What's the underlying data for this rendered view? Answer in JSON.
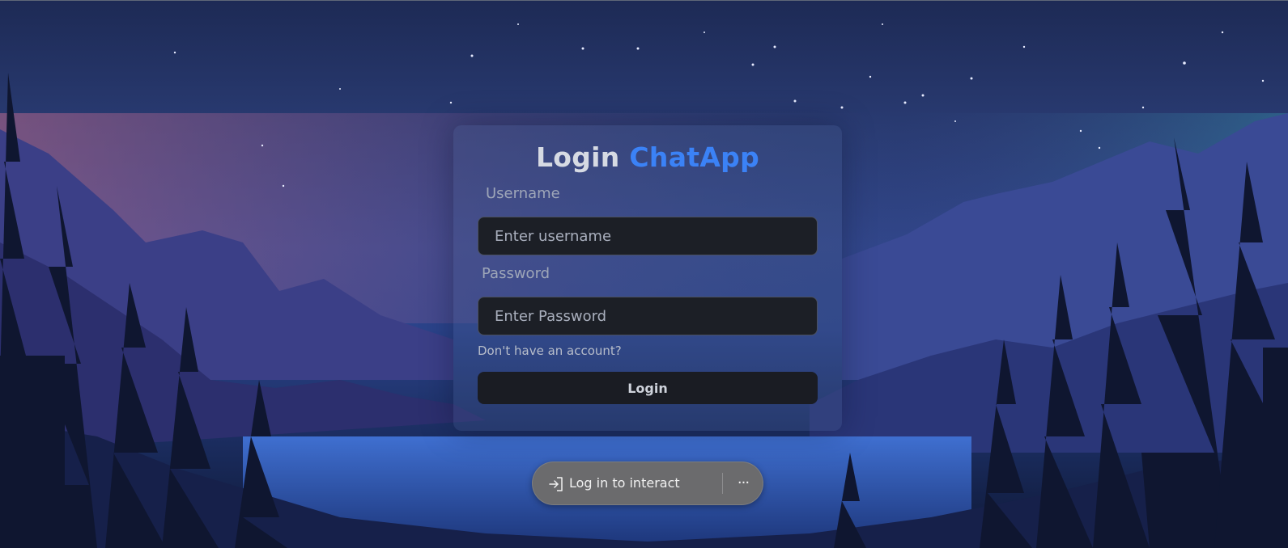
{
  "login_form": {
    "title_prefix": "Login",
    "title_brand": "ChatApp",
    "username_label": "Username",
    "username_placeholder": "Enter username",
    "username_value": "",
    "password_label": "Password",
    "password_placeholder": "Enter Password",
    "password_value": "",
    "signup_prompt": "Don't have an account?",
    "submit_label": "Login"
  },
  "interact_bar": {
    "icon": "login-arrow-icon",
    "label": "Log in to interact",
    "more_icon": "more-horizontal-icon",
    "more_glyph": "···"
  },
  "colors": {
    "brand_accent": "#3b82f6",
    "input_background": "#1c1f26",
    "button_background": "#1a1c23",
    "pill_background": "#6b6b6d"
  }
}
